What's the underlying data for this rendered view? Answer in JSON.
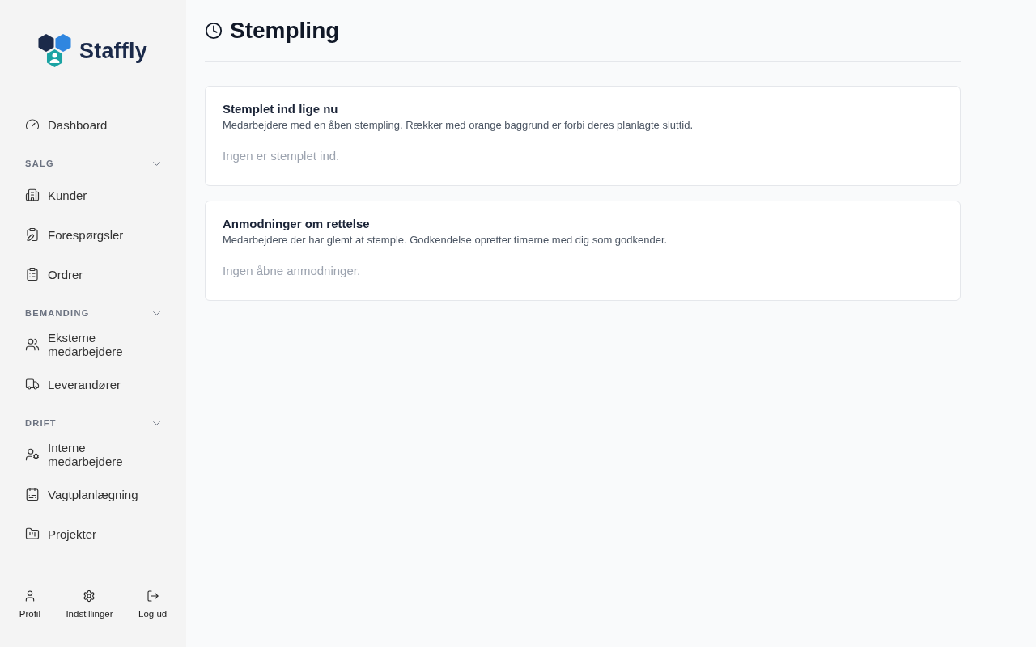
{
  "brand": {
    "name": "Staffly"
  },
  "nav": [
    {
      "kind": "link",
      "label": "Dashboard"
    },
    {
      "kind": "section",
      "label": "SALG",
      "expanded": true,
      "items": [
        {
          "label": "Kunder"
        },
        {
          "label": "Forespørgsler"
        },
        {
          "label": "Ordrer"
        }
      ]
    },
    {
      "kind": "section",
      "label": "BEMANDING",
      "expanded": true,
      "items": [
        {
          "label": "Eksterne medarbejdere"
        },
        {
          "label": "Leverandører"
        }
      ]
    },
    {
      "kind": "section",
      "label": "DRIFT",
      "expanded": true,
      "items": [
        {
          "label": "Interne medarbejdere"
        },
        {
          "label": "Vagtplanlægning"
        },
        {
          "label": "Projekter"
        }
      ]
    }
  ],
  "footer": [
    {
      "label": "Profil"
    },
    {
      "label": "Indstillinger"
    },
    {
      "label": "Log ud"
    }
  ],
  "page": {
    "title": "Stempling"
  },
  "cards": [
    {
      "title": "Stemplet ind lige nu",
      "description": "Medarbejdere med en åben stempling. Rækker med orange baggrund er forbi deres planlagte sluttid.",
      "empty": "Ingen er stemplet ind."
    },
    {
      "title": "Anmodninger om rettelse",
      "description": "Medarbejdere der har glemt at stemple. Godkendelse opretter timerne med dig som godkender.",
      "empty": "Ingen åbne anmodninger."
    }
  ]
}
